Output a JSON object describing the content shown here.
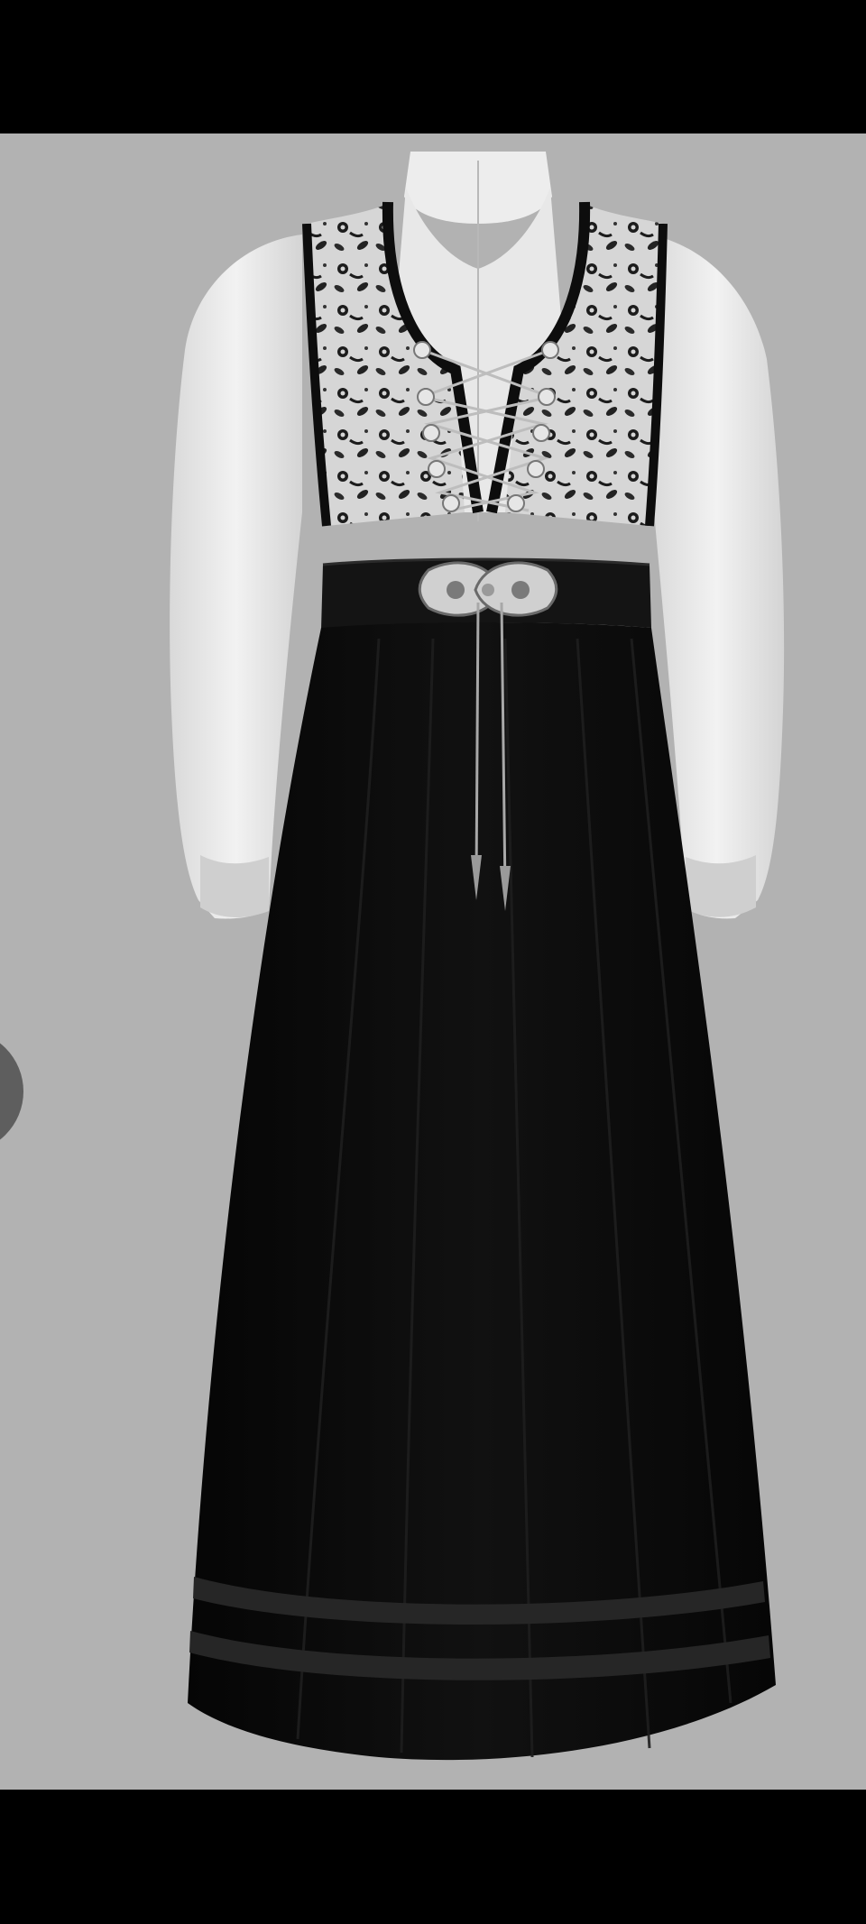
{
  "viewer": {
    "background_color": "#000000",
    "photo_background_color": "#b2b2b2",
    "image_subject_icon": "garment-photo",
    "side_handle_icon": "side-panel-handle"
  }
}
